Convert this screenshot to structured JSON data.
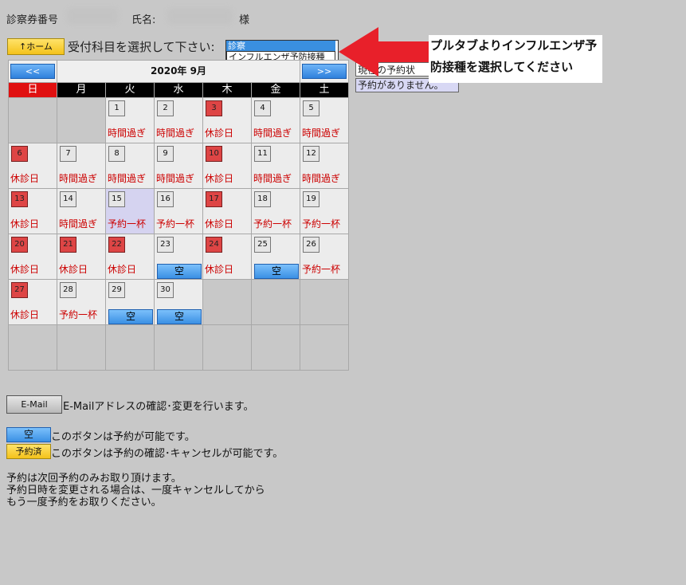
{
  "header": {
    "ticket_label": "診察券番号",
    "name_label": "氏名:",
    "honorific": "様"
  },
  "toolbar": {
    "home_label": "↑ホーム",
    "select_label": "受付科目を選択して下さい:",
    "dropdown_options": [
      "診察",
      "インフルエンザ予防接種"
    ]
  },
  "annotation": {
    "callout_line1": "プルタブよりインフルエンザ予",
    "callout_line2": "防接種を選択してください",
    "arrow_color": "#e8202a"
  },
  "side_panel": {
    "partial_status": "現在の予約状",
    "no_reservation": "予約がありません。"
  },
  "calendar": {
    "title": "2020年 9月",
    "prev_label": "<<",
    "next_label": ">>",
    "weekdays": [
      "日",
      "月",
      "火",
      "水",
      "木",
      "金",
      "土"
    ],
    "weeks": [
      [
        null,
        null,
        {
          "d": "1",
          "s": "時間過ぎ"
        },
        {
          "d": "2",
          "s": "時間過ぎ"
        },
        {
          "d": "3",
          "s": "休診日",
          "h": true
        },
        {
          "d": "4",
          "s": "時間過ぎ"
        },
        {
          "d": "5",
          "s": "時間過ぎ"
        }
      ],
      [
        {
          "d": "6",
          "s": "休診日",
          "h": true
        },
        {
          "d": "7",
          "s": "時間過ぎ"
        },
        {
          "d": "8",
          "s": "時間過ぎ"
        },
        {
          "d": "9",
          "s": "時間過ぎ"
        },
        {
          "d": "10",
          "s": "休診日",
          "h": true
        },
        {
          "d": "11",
          "s": "時間過ぎ"
        },
        {
          "d": "12",
          "s": "時間過ぎ"
        }
      ],
      [
        {
          "d": "13",
          "s": "休診日",
          "h": true
        },
        {
          "d": "14",
          "s": "時間過ぎ"
        },
        {
          "d": "15",
          "s": "予約一杯",
          "today": true
        },
        {
          "d": "16",
          "s": "予約一杯"
        },
        {
          "d": "17",
          "s": "休診日",
          "h": true
        },
        {
          "d": "18",
          "s": "予約一杯"
        },
        {
          "d": "19",
          "s": "予約一杯"
        }
      ],
      [
        {
          "d": "20",
          "s": "休診日",
          "h": true
        },
        {
          "d": "21",
          "s": "休診日",
          "h": true
        },
        {
          "d": "22",
          "s": "休診日",
          "h": true
        },
        {
          "d": "23",
          "btn": "空"
        },
        {
          "d": "24",
          "s": "休診日",
          "h": true
        },
        {
          "d": "25",
          "btn": "空"
        },
        {
          "d": "26",
          "s": "予約一杯"
        }
      ],
      [
        {
          "d": "27",
          "s": "休診日",
          "h": true
        },
        {
          "d": "28",
          "s": "予約一杯"
        },
        {
          "d": "29",
          "btn": "空"
        },
        {
          "d": "30",
          "btn": "空"
        },
        null,
        null,
        null
      ],
      [
        null,
        null,
        null,
        null,
        null,
        null,
        null
      ]
    ]
  },
  "email": {
    "button_label": "E-Mail",
    "description": "E-Mailアドレスの確認･変更を行います。"
  },
  "legend": {
    "empty_label": "空",
    "empty_text": "このボタンは予約が可能です。",
    "done_label": "予約済",
    "done_text": "このボタンは予約の確認･キャンセルが可能です。"
  },
  "notes": [
    "予約は次回予約のみお取り頂けます。",
    "予約日時を変更される場合は、一度キャンセルしてから",
    "もう一度予約をお取りください。"
  ]
}
